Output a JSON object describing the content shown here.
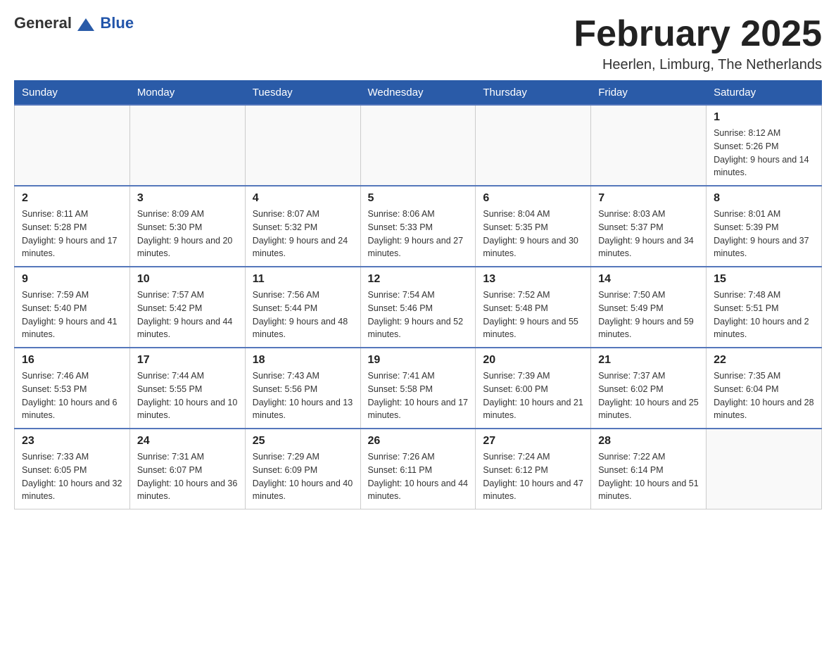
{
  "logo": {
    "general": "General",
    "blue": "Blue"
  },
  "title": "February 2025",
  "location": "Heerlen, Limburg, The Netherlands",
  "days_of_week": [
    "Sunday",
    "Monday",
    "Tuesday",
    "Wednesday",
    "Thursday",
    "Friday",
    "Saturday"
  ],
  "weeks": [
    [
      {
        "day": "",
        "info": ""
      },
      {
        "day": "",
        "info": ""
      },
      {
        "day": "",
        "info": ""
      },
      {
        "day": "",
        "info": ""
      },
      {
        "day": "",
        "info": ""
      },
      {
        "day": "",
        "info": ""
      },
      {
        "day": "1",
        "info": "Sunrise: 8:12 AM\nSunset: 5:26 PM\nDaylight: 9 hours and 14 minutes."
      }
    ],
    [
      {
        "day": "2",
        "info": "Sunrise: 8:11 AM\nSunset: 5:28 PM\nDaylight: 9 hours and 17 minutes."
      },
      {
        "day": "3",
        "info": "Sunrise: 8:09 AM\nSunset: 5:30 PM\nDaylight: 9 hours and 20 minutes."
      },
      {
        "day": "4",
        "info": "Sunrise: 8:07 AM\nSunset: 5:32 PM\nDaylight: 9 hours and 24 minutes."
      },
      {
        "day": "5",
        "info": "Sunrise: 8:06 AM\nSunset: 5:33 PM\nDaylight: 9 hours and 27 minutes."
      },
      {
        "day": "6",
        "info": "Sunrise: 8:04 AM\nSunset: 5:35 PM\nDaylight: 9 hours and 30 minutes."
      },
      {
        "day": "7",
        "info": "Sunrise: 8:03 AM\nSunset: 5:37 PM\nDaylight: 9 hours and 34 minutes."
      },
      {
        "day": "8",
        "info": "Sunrise: 8:01 AM\nSunset: 5:39 PM\nDaylight: 9 hours and 37 minutes."
      }
    ],
    [
      {
        "day": "9",
        "info": "Sunrise: 7:59 AM\nSunset: 5:40 PM\nDaylight: 9 hours and 41 minutes."
      },
      {
        "day": "10",
        "info": "Sunrise: 7:57 AM\nSunset: 5:42 PM\nDaylight: 9 hours and 44 minutes."
      },
      {
        "day": "11",
        "info": "Sunrise: 7:56 AM\nSunset: 5:44 PM\nDaylight: 9 hours and 48 minutes."
      },
      {
        "day": "12",
        "info": "Sunrise: 7:54 AM\nSunset: 5:46 PM\nDaylight: 9 hours and 52 minutes."
      },
      {
        "day": "13",
        "info": "Sunrise: 7:52 AM\nSunset: 5:48 PM\nDaylight: 9 hours and 55 minutes."
      },
      {
        "day": "14",
        "info": "Sunrise: 7:50 AM\nSunset: 5:49 PM\nDaylight: 9 hours and 59 minutes."
      },
      {
        "day": "15",
        "info": "Sunrise: 7:48 AM\nSunset: 5:51 PM\nDaylight: 10 hours and 2 minutes."
      }
    ],
    [
      {
        "day": "16",
        "info": "Sunrise: 7:46 AM\nSunset: 5:53 PM\nDaylight: 10 hours and 6 minutes."
      },
      {
        "day": "17",
        "info": "Sunrise: 7:44 AM\nSunset: 5:55 PM\nDaylight: 10 hours and 10 minutes."
      },
      {
        "day": "18",
        "info": "Sunrise: 7:43 AM\nSunset: 5:56 PM\nDaylight: 10 hours and 13 minutes."
      },
      {
        "day": "19",
        "info": "Sunrise: 7:41 AM\nSunset: 5:58 PM\nDaylight: 10 hours and 17 minutes."
      },
      {
        "day": "20",
        "info": "Sunrise: 7:39 AM\nSunset: 6:00 PM\nDaylight: 10 hours and 21 minutes."
      },
      {
        "day": "21",
        "info": "Sunrise: 7:37 AM\nSunset: 6:02 PM\nDaylight: 10 hours and 25 minutes."
      },
      {
        "day": "22",
        "info": "Sunrise: 7:35 AM\nSunset: 6:04 PM\nDaylight: 10 hours and 28 minutes."
      }
    ],
    [
      {
        "day": "23",
        "info": "Sunrise: 7:33 AM\nSunset: 6:05 PM\nDaylight: 10 hours and 32 minutes."
      },
      {
        "day": "24",
        "info": "Sunrise: 7:31 AM\nSunset: 6:07 PM\nDaylight: 10 hours and 36 minutes."
      },
      {
        "day": "25",
        "info": "Sunrise: 7:29 AM\nSunset: 6:09 PM\nDaylight: 10 hours and 40 minutes."
      },
      {
        "day": "26",
        "info": "Sunrise: 7:26 AM\nSunset: 6:11 PM\nDaylight: 10 hours and 44 minutes."
      },
      {
        "day": "27",
        "info": "Sunrise: 7:24 AM\nSunset: 6:12 PM\nDaylight: 10 hours and 47 minutes."
      },
      {
        "day": "28",
        "info": "Sunrise: 7:22 AM\nSunset: 6:14 PM\nDaylight: 10 hours and 51 minutes."
      },
      {
        "day": "",
        "info": ""
      }
    ]
  ]
}
